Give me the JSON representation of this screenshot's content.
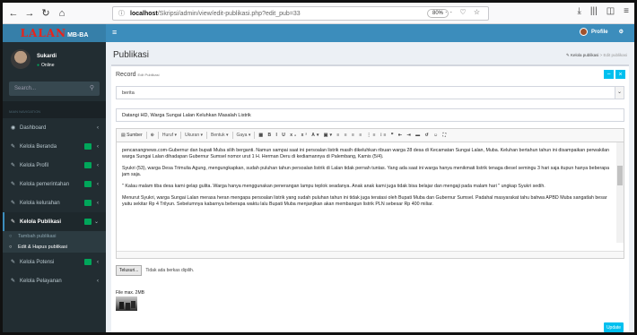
{
  "browser": {
    "url_host": "localhost",
    "url_path": "/Skripsi/admin/view/edit-publikasi.php?edit_pub=33",
    "zoom": "80%"
  },
  "header": {
    "logo": "LALAN",
    "logo_sub": "MB-BA",
    "profile_label": "Profile"
  },
  "sidebar": {
    "user_name": "Sukardi",
    "user_status": "Online",
    "search_placeholder": "Search...",
    "menu_header": "MAIN NAVIGATION",
    "items": [
      {
        "label": "Dashboard"
      },
      {
        "label": "Kelola Beranda"
      },
      {
        "label": "Kelola Profil"
      },
      {
        "label": "Kelola pemerintahan"
      },
      {
        "label": "Kelola kelurahan"
      },
      {
        "label": "Kelola Publikasi"
      },
      {
        "label": "Kelola Potensi"
      },
      {
        "label": "Kelola Pelayanan"
      }
    ],
    "sub_items": [
      {
        "label": "Tambah publikasi"
      },
      {
        "label": "Edit & Hapus publikasi"
      }
    ]
  },
  "main": {
    "page_title": "Publikasi",
    "breadcrumb": [
      "Kelola publikasi",
      "Edit publikasi"
    ],
    "box_title": "Record",
    "box_subtitle": "Edit Publikasi",
    "category_value": "berita",
    "title_value": "Datangi HD, Warga Sungai Lalan Keluhkan Masalah Listrik",
    "toolbar": {
      "source": "Sumber",
      "format": "Huruf",
      "size": "Ukuran",
      "style": "Bentuk",
      "styles": "Gaya"
    },
    "paragraphs": [
      "pencanangnews.com-Gubernur dan bupati Muba silih berganti. Namun sampai saat ini persoalan listrik masih dikeluhkan ribuan warga 28 desa di Kecamatan Sungai Lalan, Muba. Keluhan bertahun tahun ini disampaikan perwakilan warga Sungai Lalan dihadapan Gubernur Sumsel nomor urut 1 H. Herman Deru di kediamannya di Palembang, Kamis (5/4).",
      "Syukri (53), warga Desa Trimulia Agung, mengungkapkan, sudah puluhan tahun persoalan listrik di Lalan tidak pernah tuntas. Yang ada saat ini warga hanya menikmati listrik tenaga diesel semingu 3 hari saja itupun hanya beberapa jam saja.",
      "\" Kalau malam tiba desa kami gelap gulita. Warga hanya menggunakan penerangan lampu teplok seadanya. Anak anak kami juga tidak bisa belajar dan mengaji pada malam hari \" ungkap Syukri sedih.",
      "Menurut Syukri, warga Sungai Lalan merasa heran mengapa persoalan listrik yang sudah puluhan tahun ini tidak juga teratasi oleh Bupati Muba dan Gubernur Sumsel. Padahal masyarakat tahu bahwa APBD Muba sangatlah besar yaitu sekitar Rp 4 Trilyun. Sebelumnya kabarnya beberapa waktu lalu Bupati Muba menjanjikan akan membangun listrik PLN sebesar Rp 400 miliar."
    ],
    "file_button": "Telusuri...",
    "file_status": "Tidak ada berkas dipilih.",
    "file_max": "File max. 2MB",
    "update_button": "Update"
  }
}
